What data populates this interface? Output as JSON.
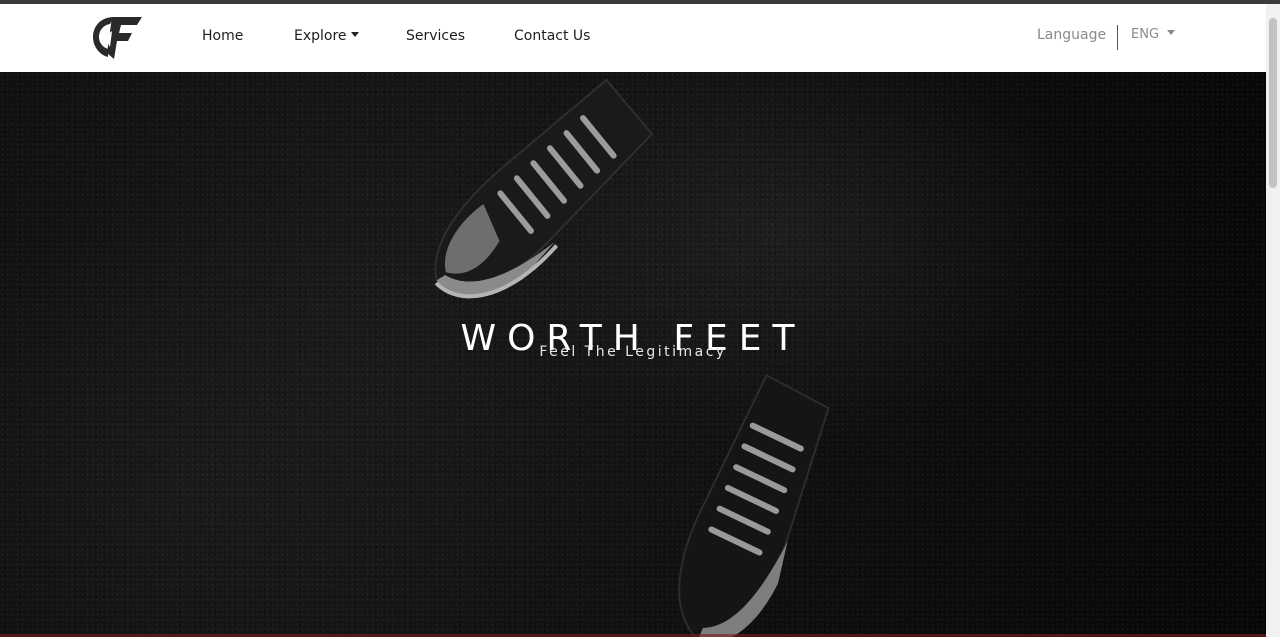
{
  "nav": {
    "links": [
      {
        "label": "Home"
      },
      {
        "label": "Explore"
      },
      {
        "label": "Services"
      },
      {
        "label": "Contact Us"
      }
    ],
    "language_label": "Language",
    "language_value": "ENG"
  },
  "hero": {
    "title": "WORTH FEET",
    "subtitle": "Feel The Legitimacy"
  },
  "icons": {
    "logo": "wf-logo-icon",
    "dropdown": "caret-down-icon"
  },
  "colors": {
    "navbar_bg": "#ffffff",
    "hero_bg": "#0c0c0c",
    "text_dark": "#1e1e1e",
    "text_muted": "#8a8a8a"
  }
}
